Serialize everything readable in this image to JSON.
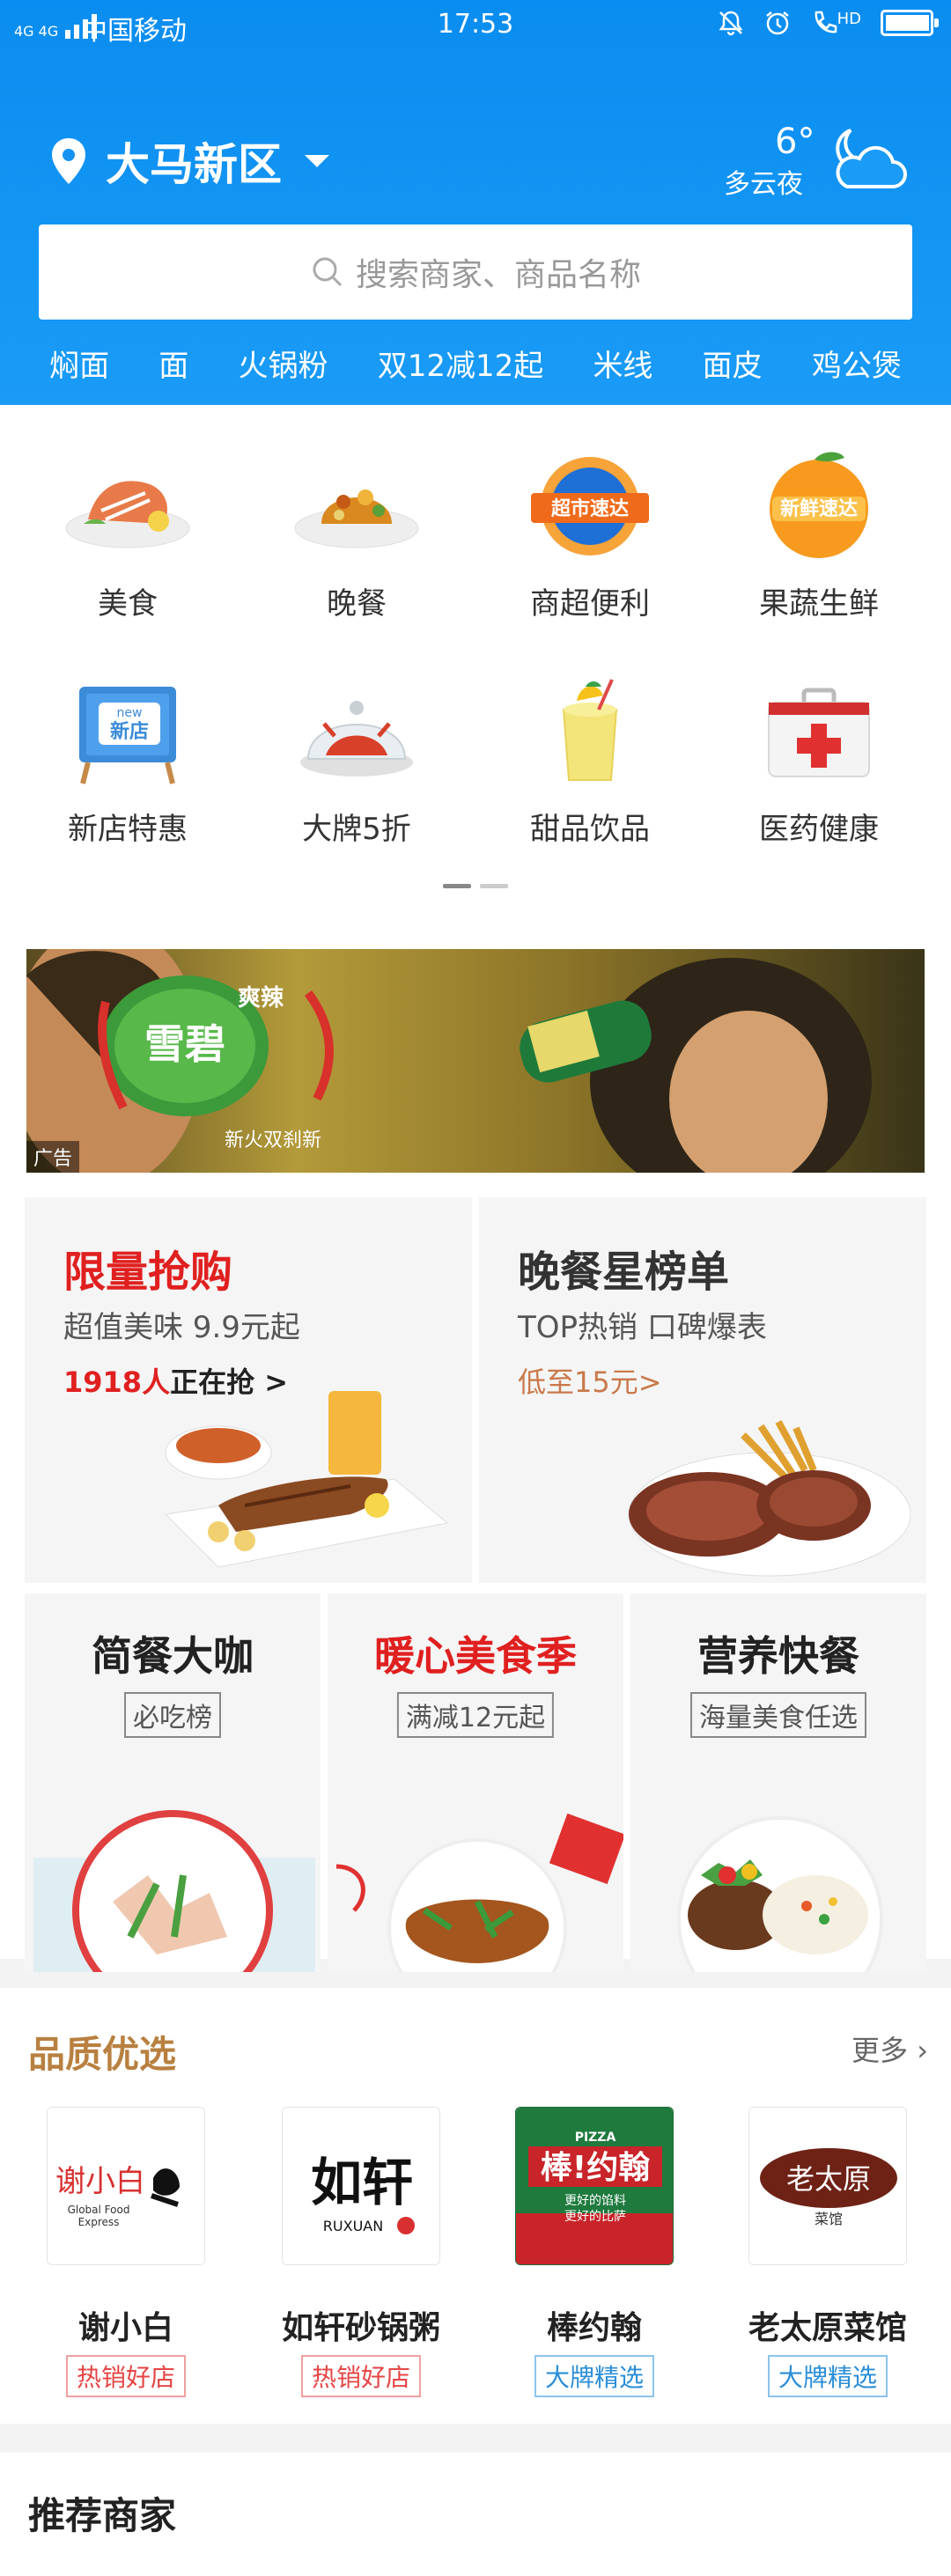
{
  "status_bar": {
    "network": "4G 4G",
    "carrier": "中国移动",
    "time": "17:53",
    "hd": "HD"
  },
  "header": {
    "location": "大马新区",
    "weather_temp": "6°",
    "weather_desc": "多云夜",
    "search_placeholder": "搜索商家、商品名称"
  },
  "hot_words": [
    "焖面",
    "面",
    "火锅粉",
    "双12减12起",
    "米线",
    "面皮",
    "鸡公煲"
  ],
  "categories": [
    {
      "label": "美食",
      "icon": "food-plate-icon"
    },
    {
      "label": "晚餐",
      "icon": "dinner-plate-icon"
    },
    {
      "label": "商超便利",
      "icon": "supermarket-express-icon",
      "icon_text": "超市速达"
    },
    {
      "label": "果蔬生鲜",
      "icon": "fresh-express-icon",
      "icon_text": "新鲜速达"
    },
    {
      "label": "新店特惠",
      "icon": "new-store-sign-icon",
      "icon_text": "新店",
      "icon_subtext": "new"
    },
    {
      "label": "大牌5折",
      "icon": "cloche-lobster-icon"
    },
    {
      "label": "甜品饮品",
      "icon": "drink-cup-icon"
    },
    {
      "label": "医药健康",
      "icon": "medical-kit-icon"
    }
  ],
  "banner": {
    "ad_label": "广告",
    "brand_text": "雪碧",
    "slogan_top": "爽辣",
    "slogan_bottom": "新火双刹新"
  },
  "promos": {
    "flash": {
      "title": "限量抢购",
      "subtitle": "超值美味 9.9元起",
      "count": "1918人",
      "count_suffix": "正在抢 >"
    },
    "dinner_rank": {
      "title": "晚餐星榜单",
      "subtitle": "TOP热销 口碑爆表",
      "meta": "低至15元>"
    },
    "small": [
      {
        "title": "简餐大咖",
        "tag": "必吃榜",
        "title_color": "#222222"
      },
      {
        "title": "暖心美食季",
        "tag": "满减12元起",
        "title_color": "#e02020"
      },
      {
        "title": "营养快餐",
        "tag": "海量美食任选",
        "title_color": "#222222"
      }
    ]
  },
  "quality": {
    "title": "品质优选",
    "more": "更多",
    "brands": [
      {
        "name": "谢小白",
        "badge": "热销好店",
        "badge_style": "red",
        "logo_main": "谢小白",
        "logo_sub1": "Global Food",
        "logo_sub2": "Express"
      },
      {
        "name": "如轩砂锅粥",
        "badge": "热销好店",
        "badge_style": "red",
        "logo_main": "如轩",
        "logo_sub1": "RUXUAN"
      },
      {
        "name": "棒约翰",
        "badge": "大牌精选",
        "badge_style": "blue",
        "logo_main": "棒!约翰",
        "logo_sub1": "PIZZA",
        "logo_sub2": "更好的馅料",
        "logo_sub3": "更好的比萨"
      },
      {
        "name": "老太原菜馆",
        "badge": "大牌精选",
        "badge_style": "blue",
        "logo_main": "老太原",
        "logo_sub1": "菜馆"
      }
    ]
  },
  "recommend": {
    "title": "推荐商家"
  },
  "colors": {
    "header_blue": "#0a8df0",
    "flash_red": "#e02020",
    "quality_gold": "#b88040"
  }
}
